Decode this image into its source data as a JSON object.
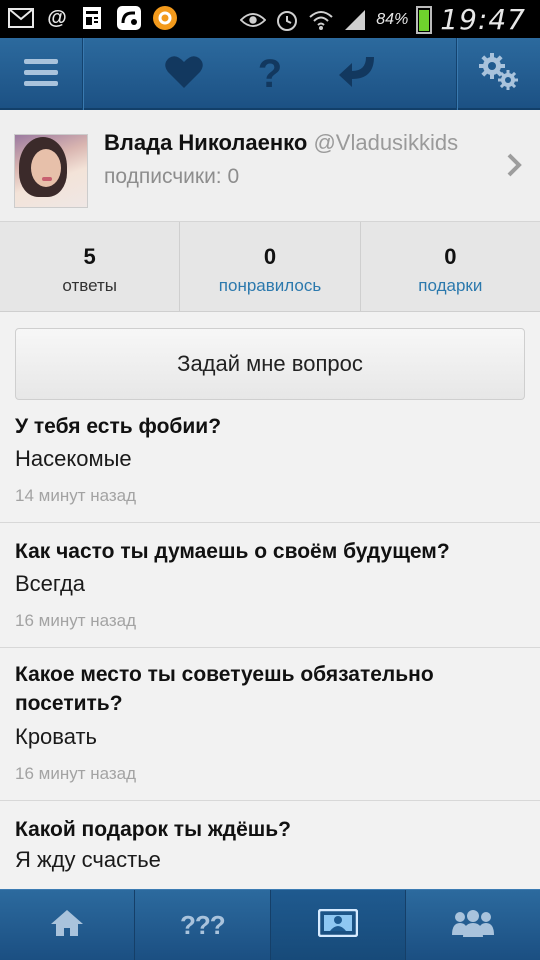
{
  "status_bar": {
    "battery_text": "84%",
    "time": "19:47",
    "icons": [
      "mail-icon",
      "at-icon",
      "news-icon",
      "app-icon",
      "orange-app-icon",
      "eye-icon",
      "alarm-icon",
      "wifi-icon",
      "signal-icon",
      "battery-icon"
    ]
  },
  "appbar": {
    "icons": [
      "menu-icon",
      "heart-icon",
      "question-icon",
      "back-arrow-icon",
      "settings-gears-icon"
    ]
  },
  "profile": {
    "name": "Влада Николаенко",
    "handle": "@Vladusikkids",
    "followers": "подписчики: 0"
  },
  "stats": [
    {
      "value": "5",
      "label": "ответы"
    },
    {
      "value": "0",
      "label": "понравилось"
    },
    {
      "value": "0",
      "label": "подарки"
    }
  ],
  "ask_button": "Задай мне вопрос",
  "questions": [
    {
      "question": "У тебя есть фобии?",
      "answer": "Насекомые",
      "time": "14 минут назад"
    },
    {
      "question": "Как часто ты думаешь о своём будущем?",
      "answer": "Всегда",
      "time": "16 минут назад"
    },
    {
      "question": "Какое место ты советуешь обязательно посетить?",
      "answer": "Кровать",
      "time": "16 минут назад"
    },
    {
      "question": "Какой подарок ты ждёшь?",
      "answer": "Я жду счастье",
      "time": ""
    }
  ],
  "bottom_nav": {
    "items": [
      "home-icon",
      "questions-icon",
      "profile-card-icon",
      "friends-icon"
    ],
    "questions_label": "???",
    "active_index": 2
  },
  "colors": {
    "bar_blue": "#1f5a8f",
    "link_blue": "#2c79ad",
    "background": "#f2f2f2"
  }
}
